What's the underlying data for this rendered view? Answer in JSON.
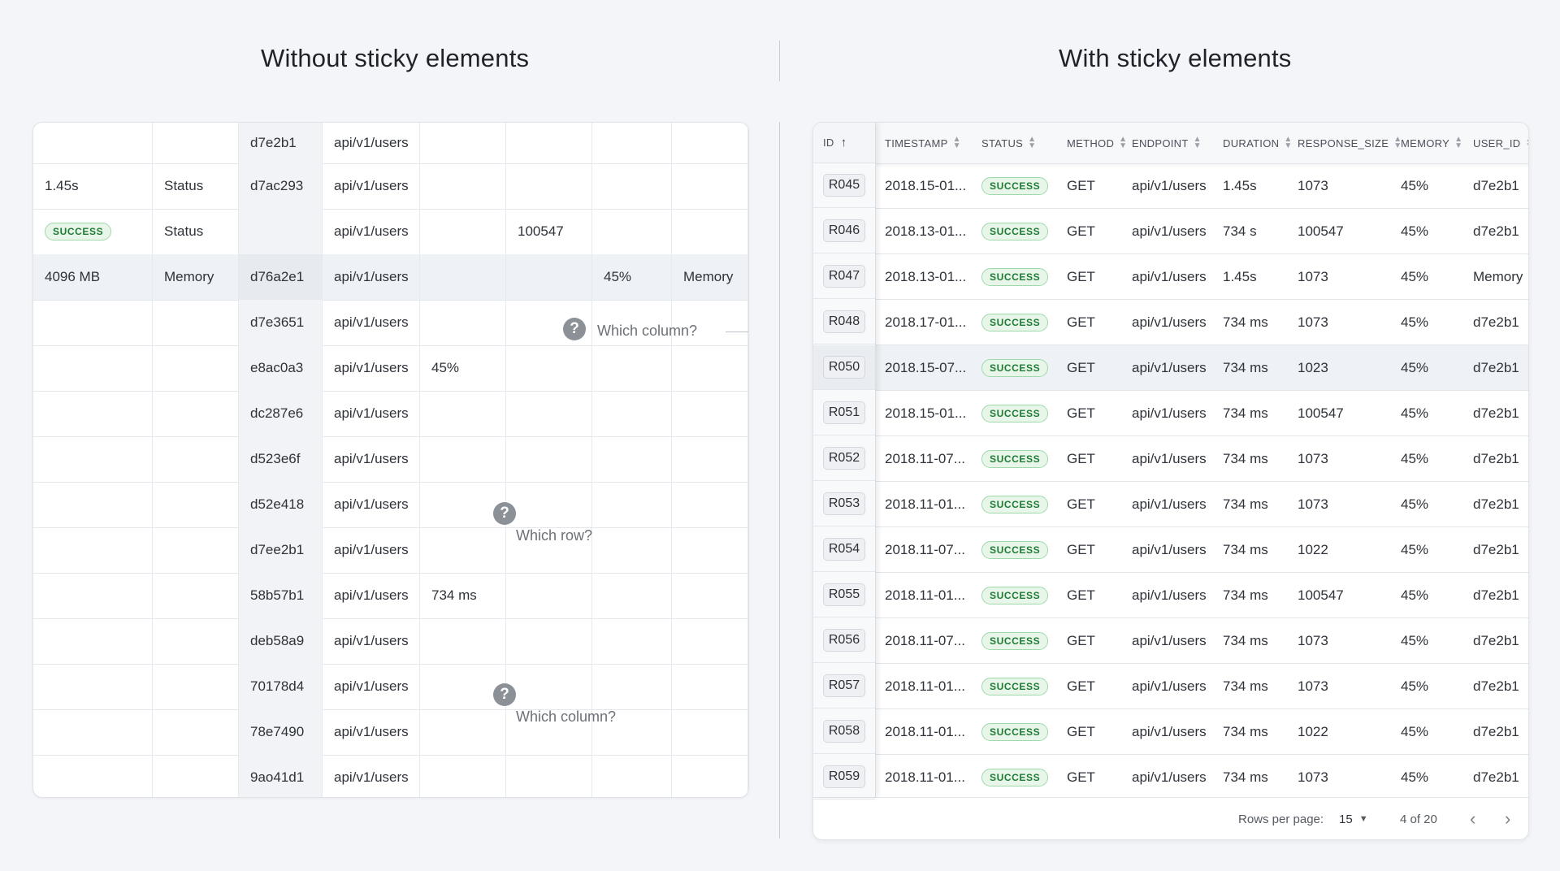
{
  "titles": {
    "left": "Without sticky elements",
    "right": "With sticky elements"
  },
  "left_table": {
    "rows": [
      [
        "",
        "",
        "d7e2b1",
        "api/v1/users",
        "",
        "",
        "",
        ""
      ],
      [
        "1.45s",
        "Status",
        "d7ac293",
        "api/v1/users",
        "",
        "",
        "",
        ""
      ],
      [
        "SUCCESS",
        "Status",
        "",
        "api/v1/users",
        "",
        "100547",
        "",
        ""
      ],
      [
        "4096 MB",
        "Memory",
        "d76a2e1",
        "api/v1/users",
        "",
        "",
        "45%",
        "Memory"
      ],
      [
        "",
        "",
        "d7e3651",
        "api/v1/users",
        "",
        "",
        "",
        ""
      ],
      [
        "",
        "",
        "e8ac0a3",
        "api/v1/users",
        "45%",
        "",
        "",
        ""
      ],
      [
        "",
        "",
        "dc287e6",
        "api/v1/users",
        "",
        "",
        "",
        ""
      ],
      [
        "",
        "",
        "d523e6f",
        "api/v1/users",
        "",
        "",
        "",
        ""
      ],
      [
        "",
        "",
        "d52e418",
        "api/v1/users",
        "",
        "",
        "",
        ""
      ],
      [
        "",
        "",
        "d7ee2b1",
        "api/v1/users",
        "",
        "",
        "",
        ""
      ],
      [
        "",
        "",
        "58b57b1",
        "api/v1/users",
        "734 ms",
        "",
        "",
        ""
      ],
      [
        "",
        "",
        "deb58a9",
        "api/v1/users",
        "",
        "",
        "",
        ""
      ],
      [
        "",
        "",
        "70178d4",
        "api/v1/users",
        "",
        "",
        "",
        ""
      ],
      [
        "",
        "",
        "78e7490",
        "api/v1/users",
        "",
        "",
        "",
        ""
      ],
      [
        "",
        "",
        "9ao41d1",
        "api/v1/users",
        "",
        "",
        "",
        ""
      ]
    ],
    "annotations": [
      "Which column?",
      "Which row?",
      "Which column?"
    ]
  },
  "right_table": {
    "columns": [
      "ID",
      "TIMESTAMP",
      "STATUS",
      "METHOD",
      "ENDPOINT",
      "DURATION",
      "RESPONSE_SIZE",
      "MEMORY",
      "USER_ID"
    ],
    "rows": [
      [
        "R045",
        "2018.15-01...",
        "SUCCESS",
        "GET",
        "api/v1/users",
        "1.45s",
        "1073",
        "45%",
        "d7e2b1"
      ],
      [
        "R046",
        "2018.13-01...",
        "SUCCESS",
        "GET",
        "api/v1/users",
        "734 s",
        "100547",
        "45%",
        "d7e2b1"
      ],
      [
        "R047",
        "2018.13-01...",
        "SUCCESS",
        "GET",
        "api/v1/users",
        "1.45s",
        "1073",
        "45%",
        "Memory"
      ],
      [
        "R048",
        "2018.17-01...",
        "SUCCESS",
        "GET",
        "api/v1/users",
        "734 ms",
        "1073",
        "45%",
        "d7e2b1"
      ],
      [
        "R050",
        "2018.15-07...",
        "SUCCESS",
        "GET",
        "api/v1/users",
        "734 ms",
        "1023",
        "45%",
        "d7e2b1"
      ],
      [
        "R051",
        "2018.15-01...",
        "SUCCESS",
        "GET",
        "api/v1/users",
        "734 ms",
        "100547",
        "45%",
        "d7e2b1"
      ],
      [
        "R052",
        "2018.11-07...",
        "SUCCESS",
        "GET",
        "api/v1/users",
        "734 ms",
        "1073",
        "45%",
        "d7e2b1"
      ],
      [
        "R053",
        "2018.11-01...",
        "SUCCESS",
        "GET",
        "api/v1/users",
        "734 ms",
        "1073",
        "45%",
        "d7e2b1"
      ],
      [
        "R054",
        "2018.11-07...",
        "SUCCESS",
        "GET",
        "api/v1/users",
        "734 ms",
        "1022",
        "45%",
        "d7e2b1"
      ],
      [
        "R055",
        "2018.11-01...",
        "SUCCESS",
        "GET",
        "api/v1/users",
        "734 ms",
        "100547",
        "45%",
        "d7e2b1"
      ],
      [
        "R056",
        "2018.11-07...",
        "SUCCESS",
        "GET",
        "api/v1/users",
        "734 ms",
        "1073",
        "45%",
        "d7e2b1"
      ],
      [
        "R057",
        "2018.11-01...",
        "SUCCESS",
        "GET",
        "api/v1/users",
        "734 ms",
        "1073",
        "45%",
        "d7e2b1"
      ],
      [
        "R058",
        "2018.11-01...",
        "SUCCESS",
        "GET",
        "api/v1/users",
        "734 ms",
        "1022",
        "45%",
        "d7e2b1"
      ],
      [
        "R059",
        "2018.11-01...",
        "SUCCESS",
        "GET",
        "api/v1/users",
        "734 ms",
        "1073",
        "45%",
        "d7e2b1"
      ]
    ],
    "footer": {
      "rows_per_page_label": "Rows per page:",
      "rows_per_page_value": "15",
      "page_info": "4 of 20"
    }
  },
  "colors": {
    "success_text": "#1f7a34",
    "success_bg": "#e8f6ea",
    "success_border": "#9fd8ab",
    "question_icon": "#8c9198"
  },
  "icons": [
    "question-icon",
    "sort-icon",
    "arrow-up-icon",
    "chevron-down-icon",
    "chevron-left-icon",
    "chevron-right-icon"
  ]
}
